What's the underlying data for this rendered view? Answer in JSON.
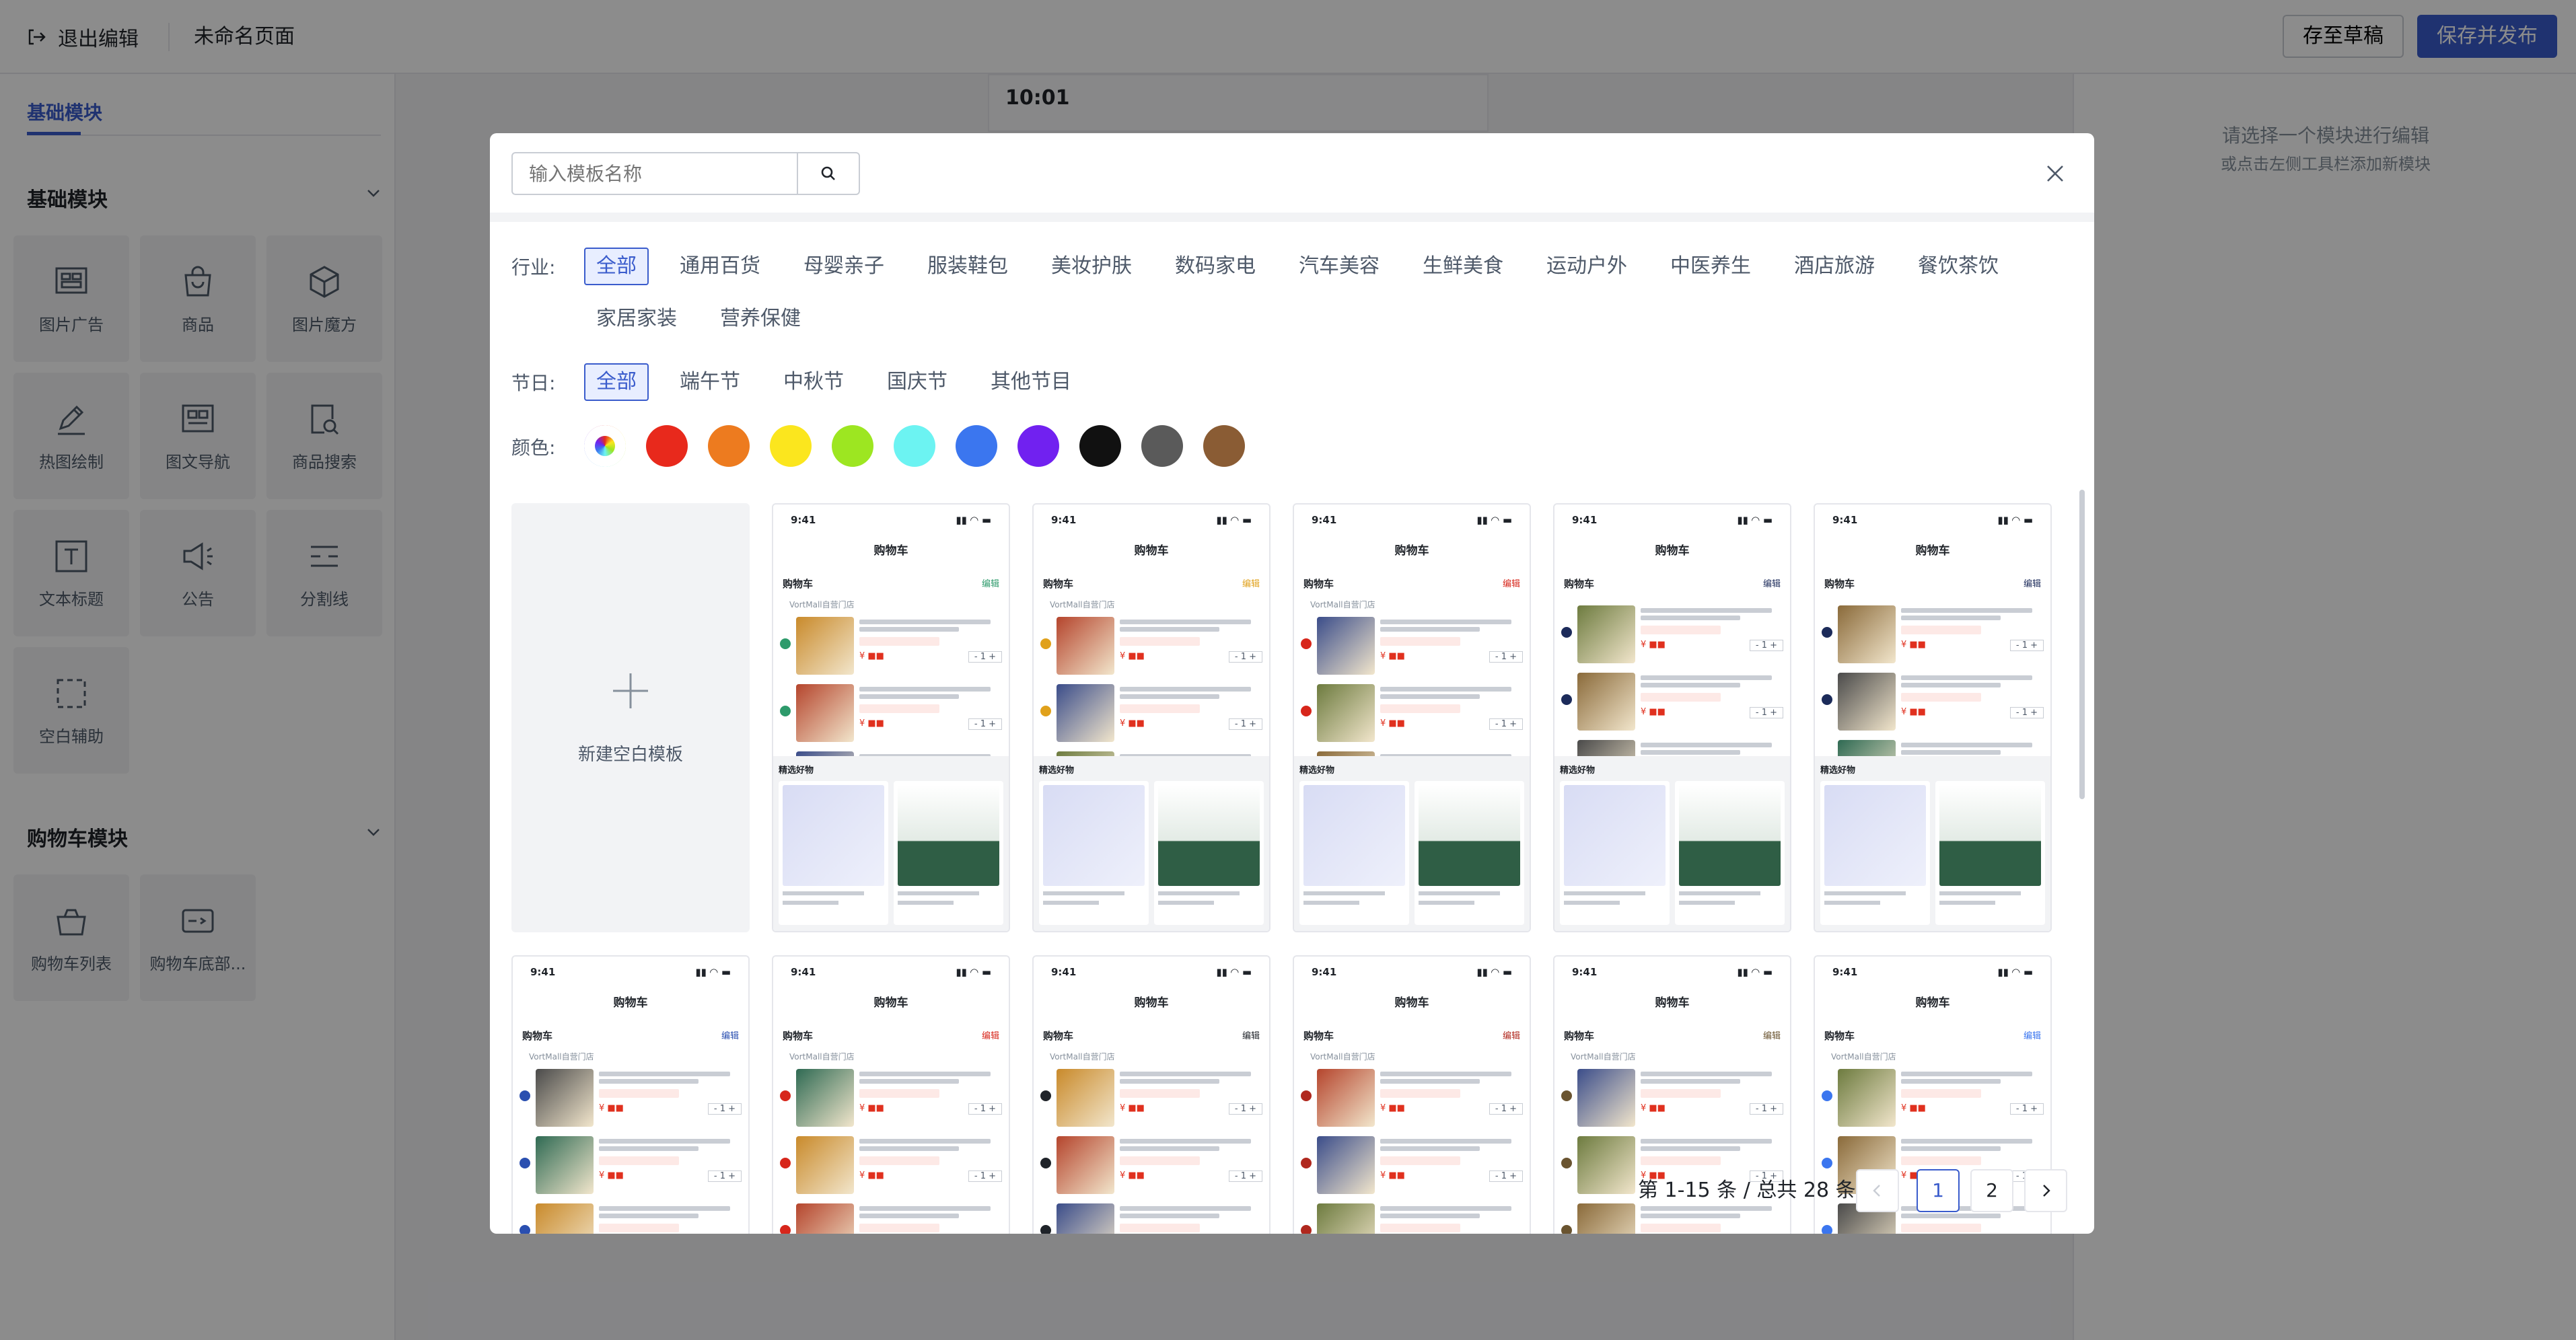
{
  "topbar": {
    "exit_label": "退出编辑",
    "page_name": "未命名页面",
    "draft_label": "存至草稿",
    "publish_label": "保存并发布"
  },
  "left_panel": {
    "tab_label": "基础模块",
    "section1_title": "基础模块",
    "section1_items": [
      "图片广告",
      "商品",
      "图片魔方",
      "热图绘制",
      "图文导航",
      "商品搜索",
      "文本标题",
      "公告",
      "分割线",
      "空白辅助"
    ],
    "section2_title": "购物车模块",
    "section2_items": [
      "购物车列表",
      "购物车底部..."
    ]
  },
  "phone": {
    "time": "10:01"
  },
  "right_panel": {
    "hint_line1": "请选择一个模块进行编辑",
    "hint_line2": "或点击左侧工具栏添加新模块"
  },
  "modal": {
    "search_placeholder": "输入模板名称",
    "industry_label": "行业:",
    "industries": [
      "全部",
      "通用百货",
      "母婴亲子",
      "服装鞋包",
      "美妆护肤",
      "数码家电",
      "汽车美容",
      "生鲜美食",
      "运动户外",
      "中医养生",
      "酒店旅游",
      "餐饮茶饮",
      "家居家装",
      "营养保健"
    ],
    "selected_industry": "全部",
    "festival_label": "节日:",
    "festivals": [
      "全部",
      "端午节",
      "中秋节",
      "国庆节",
      "其他节目"
    ],
    "selected_festival": "全部",
    "color_label": "颜色:",
    "colors": [
      "#e8291c",
      "#ed7b1f",
      "#fbe61e",
      "#9de621",
      "#6cf3f2",
      "#3b76ef",
      "#7121f0",
      "#111111",
      "#5a5a5a",
      "#8a5c34"
    ],
    "new_template_label": "新建空白模板",
    "template_cards": [
      {
        "time": "9:41",
        "title": "购物车",
        "header": "购物车",
        "edit": "编辑",
        "shop": "VortMall自营门店",
        "accent": "#2d9a6b",
        "recommend": "精选好物"
      },
      {
        "time": "9:41",
        "title": "购物车",
        "header": "购物车",
        "edit": "编辑",
        "shop": "VortMall自营门店",
        "accent": "#e0a11b",
        "recommend": "精选好物"
      },
      {
        "time": "9:41",
        "title": "购物车",
        "header": "购物车",
        "edit": "编辑",
        "shop": "VortMall自营门店",
        "accent": "#d7261b",
        "recommend": "精选好物"
      },
      {
        "time": "9:41",
        "title": "购物车",
        "header": "购物车",
        "edit": "编辑",
        "shop": "",
        "accent": "#1c2b5a",
        "recommend": "精选好物"
      },
      {
        "time": "9:41",
        "title": "购物车",
        "header": "购物车",
        "edit": "编辑",
        "shop": "",
        "accent": "#1c2b5a",
        "recommend": "精选好物"
      },
      {
        "time": "9:41",
        "title": "购物车",
        "header": "购物车",
        "edit": "编辑",
        "shop": "VortMall自营门店",
        "accent": "#2a4fb0",
        "recommend": ""
      },
      {
        "time": "9:41",
        "title": "购物车",
        "header": "购物车",
        "edit": "编辑",
        "shop": "VortMall自营门店",
        "accent": "#d7261b",
        "recommend": ""
      },
      {
        "time": "9:41",
        "title": "购物车",
        "header": "购物车",
        "edit": "编辑",
        "shop": "VortMall自营门店",
        "accent": "#1f2329",
        "recommend": ""
      },
      {
        "time": "9:41",
        "title": "购物车",
        "header": "购物车",
        "edit": "编辑",
        "shop": "VortMall自营门店",
        "accent": "#b0281e",
        "recommend": ""
      },
      {
        "time": "9:41",
        "title": "购物车",
        "header": "购物车",
        "edit": "编辑",
        "shop": "VortMall自营门店",
        "accent": "#6a5430",
        "recommend": ""
      },
      {
        "time": "9:41",
        "title": "购物车",
        "header": "购物车",
        "edit": "编辑",
        "shop": "VortMall自营门店",
        "accent": "#3b76ef",
        "recommend": ""
      }
    ],
    "pagination": {
      "summary": "第 1-15 条 / 总共 28 条",
      "pages": [
        "1",
        "2"
      ],
      "current": "1"
    }
  }
}
